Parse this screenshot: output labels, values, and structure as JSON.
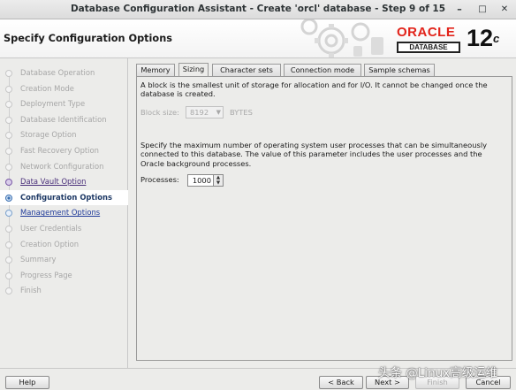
{
  "window": {
    "title": "Database Configuration Assistant - Create 'orcl' database - Step 9 of 15",
    "minimize": "–",
    "maximize": "□",
    "close": "✕"
  },
  "header": {
    "heading": "Specify Configuration Options",
    "brand_word": "ORACLE",
    "brand_sub": "DATABASE",
    "version": "12",
    "version_suffix": "c"
  },
  "nav": {
    "items": [
      {
        "label": "Database Operation",
        "state": "done"
      },
      {
        "label": "Creation Mode",
        "state": "done"
      },
      {
        "label": "Deployment Type",
        "state": "done"
      },
      {
        "label": "Database Identification",
        "state": "done"
      },
      {
        "label": "Storage Option",
        "state": "done"
      },
      {
        "label": "Fast Recovery Option",
        "state": "done"
      },
      {
        "label": "Network Configuration",
        "state": "done"
      },
      {
        "label": "Data Vault Option",
        "state": "link"
      },
      {
        "label": "Configuration Options",
        "state": "active"
      },
      {
        "label": "Management Options",
        "state": "next"
      },
      {
        "label": "User Credentials",
        "state": "pending"
      },
      {
        "label": "Creation Option",
        "state": "pending"
      },
      {
        "label": "Summary",
        "state": "pending"
      },
      {
        "label": "Progress Page",
        "state": "pending"
      },
      {
        "label": "Finish",
        "state": "pending"
      }
    ]
  },
  "tabs": [
    {
      "label": "Memory",
      "selected": false
    },
    {
      "label": "Sizing",
      "selected": true
    },
    {
      "label": "Character sets",
      "selected": false
    },
    {
      "label": "Connection mode",
      "selected": false
    },
    {
      "label": "Sample schemas",
      "selected": false
    }
  ],
  "sizing": {
    "block_text": "A block is the smallest unit of storage for allocation and for I/O. It cannot be changed once the database is created.",
    "block_size_label": "Block size:",
    "block_size_value": "8192",
    "block_size_unit": "BYTES",
    "process_text": "Specify the maximum number of operating system user processes that can be simultaneously connected to this database. The value of this parameter includes the user processes and the Oracle background processes.",
    "processes_label": "Processes:",
    "processes_value": "1000"
  },
  "buttons": {
    "help": "Help",
    "back": "< Back",
    "next": "Next >",
    "finish": "Finish",
    "cancel": "Cancel"
  },
  "watermark": "头条 @Linux高级运维",
  "colors": {
    "oracle_red": "#e2231a",
    "active_blue": "#3a6fb0",
    "link_purple": "#4a2f7a"
  }
}
